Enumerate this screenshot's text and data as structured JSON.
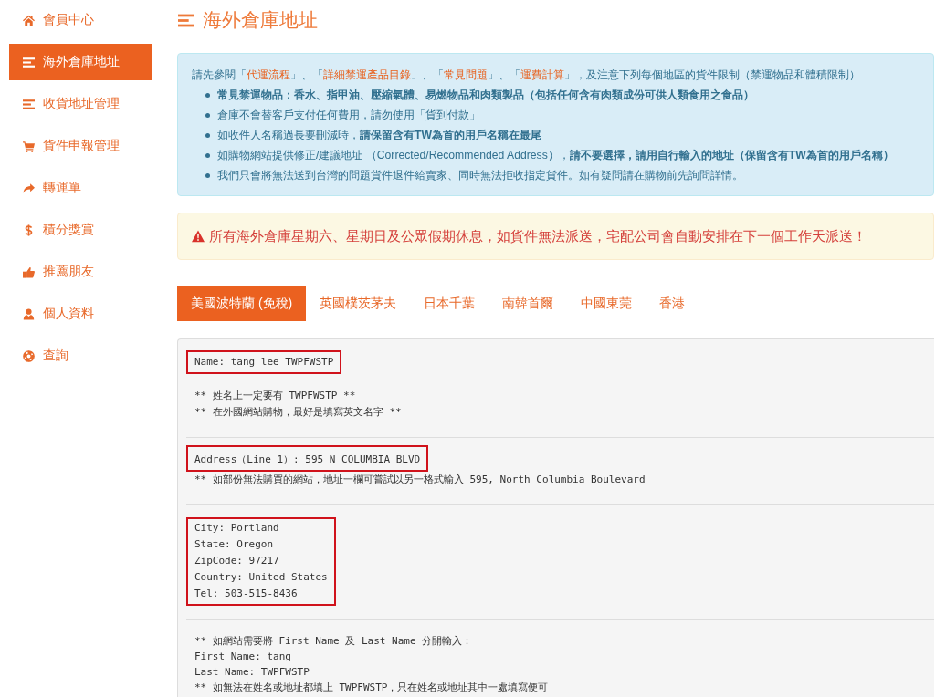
{
  "sidebar": {
    "items": [
      {
        "label": "會員中心",
        "selected": false
      },
      {
        "label": "海外倉庫地址",
        "selected": true
      },
      {
        "label": "收貨地址管理",
        "selected": false
      },
      {
        "label": "貨件申報管理",
        "selected": false
      },
      {
        "label": "轉運單",
        "selected": false
      },
      {
        "label": "積分獎賞",
        "selected": false
      },
      {
        "label": "推薦朋友",
        "selected": false
      },
      {
        "label": "個人資料",
        "selected": false
      },
      {
        "label": "查詢",
        "selected": false
      }
    ]
  },
  "page_title": "海外倉庫地址",
  "notice": {
    "intro": [
      {
        "kind": "text",
        "text": "請先參閱「"
      },
      {
        "kind": "link",
        "text": "代運流程"
      },
      {
        "kind": "text",
        "text": "」、「"
      },
      {
        "kind": "link",
        "text": "詳細禁運產品目錄"
      },
      {
        "kind": "text",
        "text": "」、「"
      },
      {
        "kind": "link",
        "text": "常見問題"
      },
      {
        "kind": "text",
        "text": "」、「"
      },
      {
        "kind": "link",
        "text": "運費計算"
      },
      {
        "kind": "text",
        "text": "」，及注意下列每個地區的貨件限制（禁運物品和體積限制）"
      }
    ],
    "bullets": [
      {
        "text": "常見禁運物品：香水、指甲油、壓縮氣體、易燃物品和肉類製品（包括任何含有肉類成份可供人類食用之食品）",
        "bold": true
      },
      {
        "text": "倉庫不會替客戶支付任何費用，請勿使用「貨到付款」",
        "bold": false
      },
      {
        "text": "如收件人名稱過長要刪減時，**請保留含有TW為首的用戶名稱在最尾**",
        "bold": false
      },
      {
        "text": "如購物網站提供修正/建議地址 （Corrected/Recommended Address），**請不要選擇，請用自行輸入的地址（保留含有TW為首的用戶名稱）**",
        "bold": false
      },
      {
        "text": "我們只會將無法送到台灣的問題貨件退件給賣家、同時無法拒收指定貨件。如有疑問請在購物前先詢問詳情。",
        "bold": false
      }
    ]
  },
  "warning": {
    "text": "所有海外倉庫星期六、星期日及公眾假期休息，如貨件無法派送，宅配公司會自動安排在下一個工作天派送！"
  },
  "tabs": [
    {
      "label": "美國波特蘭 (免稅)",
      "selected": true
    },
    {
      "label": "英國樸茨茅夫",
      "selected": false
    },
    {
      "label": "日本千葉",
      "selected": false
    },
    {
      "label": "南韓首爾",
      "selected": false
    },
    {
      "label": "中國東莞",
      "selected": false
    },
    {
      "label": "香港",
      "selected": false
    }
  ],
  "address_panel": {
    "sections": [
      {
        "highlighted": [
          "Name: tang lee TWPFWSTP"
        ],
        "notes": [
          "** 姓名上一定要有 TWPFWSTP **",
          "** 在外國網站購物，最好是填寫英文名字 **"
        ]
      },
      {
        "highlighted": [
          "Address（Line 1）: 595 N COLUMBIA BLVD"
        ],
        "notes": [
          "** 如部份無法購買的網站，地址一欄可嘗試以另一格式輸入 595, North Columbia Boulevard"
        ]
      },
      {
        "highlighted": [
          "City: Portland",
          "State: Oregon",
          "ZipCode: 97217",
          "Country: United States",
          "Tel: 503-515-8436"
        ]
      },
      {
        "notes": [
          "** 如網站需要將 First Name 及 Last Name 分開輸入：",
          "First Name: tang",
          "Last Name: TWPFWSTP",
          "** 如無法在姓名或地址都填上 TWPFWSTP，只在姓名或地址其中一處填寫便可"
        ]
      }
    ]
  }
}
